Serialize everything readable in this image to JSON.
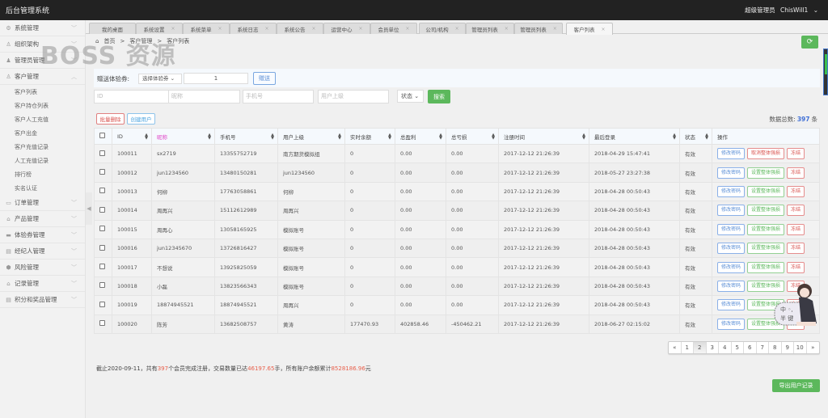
{
  "app": {
    "title": "后台管理系统",
    "user_role": "超级管理员",
    "user_name": "ChisWill1"
  },
  "sidebar": {
    "items": [
      {
        "label": "系统管理",
        "icon": "gear-icon",
        "expanded": false
      },
      {
        "label": "组织架构",
        "icon": "user-outline-icon",
        "expanded": false
      },
      {
        "label": "管理员管理",
        "icon": "user-icon",
        "expanded": false
      },
      {
        "label": "客户管理",
        "icon": "user-outline-icon",
        "expanded": true,
        "children": [
          "客户列表",
          "客户持仓列表",
          "客户人工充值",
          "客户出金",
          "客户充值记录",
          "人工充值记录",
          "排行榜",
          "实名认证"
        ]
      },
      {
        "label": "订单管理",
        "icon": "folder-icon",
        "expanded": false
      },
      {
        "label": "产品管理",
        "icon": "lock-icon",
        "expanded": false
      },
      {
        "label": "体验券管理",
        "icon": "card-icon",
        "expanded": false
      },
      {
        "label": "经纪人管理",
        "icon": "doc-icon",
        "expanded": false
      },
      {
        "label": "风险管理",
        "icon": "shield-icon",
        "expanded": false
      },
      {
        "label": "记录管理",
        "icon": "lock-icon",
        "expanded": false
      },
      {
        "label": "积分和奖品管理",
        "icon": "doc-icon",
        "expanded": false
      }
    ]
  },
  "tabs": [
    {
      "label": "我的桌面",
      "closable": false
    },
    {
      "label": "系统设置",
      "closable": true
    },
    {
      "label": "系统菜单",
      "closable": true
    },
    {
      "label": "系统日志",
      "closable": true
    },
    {
      "label": "系统公告",
      "closable": true
    },
    {
      "label": "运营中心",
      "closable": true
    },
    {
      "label": "会员单位",
      "closable": true
    },
    {
      "label": "公司/机构",
      "closable": true
    },
    {
      "label": "管理员列表",
      "closable": true
    },
    {
      "label": "管理员列表",
      "closable": true
    },
    {
      "label": "客户列表",
      "closable": true,
      "active": true
    }
  ],
  "breadcrumb": [
    "首页",
    "客户管理",
    "客户列表"
  ],
  "breadcrumb_sep": ">",
  "watermark": "BOSS 资源",
  "gift": {
    "label": "赠送体验券:",
    "select_value": "选择体验券",
    "qty_value": "1",
    "button": "赠送"
  },
  "filters": {
    "id_placeholder": "ID",
    "nick_placeholder": "昵称",
    "phone_placeholder": "手机号",
    "parent_placeholder": "用户上级",
    "status_value": "状态",
    "search_button": "搜索"
  },
  "toolbar": {
    "batch_delete": "批量删除",
    "create_user": "创建用户"
  },
  "total": {
    "label": "数据总数:",
    "count": "397",
    "unit": "条"
  },
  "table": {
    "headers": [
      "ID",
      "昵称",
      "手机号",
      "用户上级",
      "实时余额",
      "总盈利",
      "总亏损",
      "注册时间",
      "最后登录",
      "状态",
      "操作"
    ],
    "rows": [
      {
        "id": "100011",
        "nick": "sx2719",
        "phone": "13355752719",
        "parent": "南方期货模拟组",
        "balance": "0",
        "profit": "0.00",
        "loss": "0.00",
        "reg": "2017-12-12 21:26:39",
        "last": "2018-04-29 15:47:41",
        "status": "有效",
        "risk_action": "取消整体强损",
        "risk_color": "red"
      },
      {
        "id": "100012",
        "nick": "jun1234560",
        "phone": "13480150281",
        "parent": "jun1234560",
        "balance": "0",
        "profit": "0.00",
        "loss": "0.00",
        "reg": "2017-12-12 21:26:39",
        "last": "2018-05-27 23:27:38",
        "status": "有效",
        "risk_action": "设置整体强损",
        "risk_color": "green"
      },
      {
        "id": "100013",
        "nick": "何柳",
        "phone": "17763058861",
        "parent": "何柳",
        "balance": "0",
        "profit": "0.00",
        "loss": "0.00",
        "reg": "2017-12-12 21:26:39",
        "last": "2018-04-28 00:50:43",
        "status": "有效",
        "risk_action": "设置整体强损",
        "risk_color": "green"
      },
      {
        "id": "100014",
        "nick": "周再兴",
        "phone": "15112612989",
        "parent": "周再兴",
        "balance": "0",
        "profit": "0.00",
        "loss": "0.00",
        "reg": "2017-12-12 21:26:39",
        "last": "2018-04-28 00:50:43",
        "status": "有效",
        "risk_action": "设置整体强损",
        "risk_color": "green"
      },
      {
        "id": "100015",
        "nick": "周再心",
        "phone": "13058165925",
        "parent": "模拟账号",
        "balance": "0",
        "profit": "0.00",
        "loss": "0.00",
        "reg": "2017-12-12 21:26:39",
        "last": "2018-04-28 00:50:43",
        "status": "有效",
        "risk_action": "设置整体强损",
        "risk_color": "green"
      },
      {
        "id": "100016",
        "nick": "jun12345670",
        "phone": "13726816427",
        "parent": "模拟账号",
        "balance": "0",
        "profit": "0.00",
        "loss": "0.00",
        "reg": "2017-12-12 21:26:39",
        "last": "2018-04-28 00:50:43",
        "status": "有效",
        "risk_action": "设置整体强损",
        "risk_color": "green"
      },
      {
        "id": "100017",
        "nick": "不想说",
        "phone": "13925825059",
        "parent": "模拟账号",
        "balance": "0",
        "profit": "0.00",
        "loss": "0.00",
        "reg": "2017-12-12 21:26:39",
        "last": "2018-04-28 00:50:43",
        "status": "有效",
        "risk_action": "设置整体强损",
        "risk_color": "green"
      },
      {
        "id": "100018",
        "nick": "小磊",
        "phone": "13823566343",
        "parent": "模拟账号",
        "balance": "0",
        "profit": "0.00",
        "loss": "0.00",
        "reg": "2017-12-12 21:26:39",
        "last": "2018-04-28 00:50:43",
        "status": "有效",
        "risk_action": "设置整体强损",
        "risk_color": "green"
      },
      {
        "id": "100019",
        "nick": "18874945521",
        "phone": "18874945521",
        "parent": "周再兴",
        "balance": "0",
        "profit": "0.00",
        "loss": "0.00",
        "reg": "2017-12-12 21:26:39",
        "last": "2018-04-28 00:50:43",
        "status": "有效",
        "risk_action": "设置整体强损",
        "risk_color": "green"
      },
      {
        "id": "100020",
        "nick": "陈芳",
        "phone": "13682508757",
        "parent": "黄涛",
        "balance": "177470.93",
        "profit": "402858.46",
        "loss": "-450462.21",
        "reg": "2017-12-12 21:26:39",
        "last": "2018-06-27 02:15:02",
        "status": "有效",
        "risk_action": "设置整体强损",
        "risk_color": "green"
      }
    ],
    "row_actions": {
      "change_password": "修改密码",
      "freeze": "冻结"
    }
  },
  "pagination": {
    "prev": "«",
    "next": "»",
    "pages": [
      "1",
      "2",
      "3",
      "4",
      "5",
      "6",
      "7",
      "8",
      "9",
      "10"
    ],
    "current": "2"
  },
  "summary": {
    "prefix": "截止2020-09-11，共有",
    "members": "397",
    "mid1": "个会员完成注册，交易数量已达",
    "volume": "46197.65",
    "mid2": "手，所有账户余额累计",
    "balance": "8528186.96",
    "suffix": "元"
  },
  "export_button": "导出用户记录",
  "colors": {
    "brand_green": "#5cb85c",
    "topbar": "#222222",
    "highlight_red": "#e8604c",
    "link_blue": "#3f6fd6"
  }
}
